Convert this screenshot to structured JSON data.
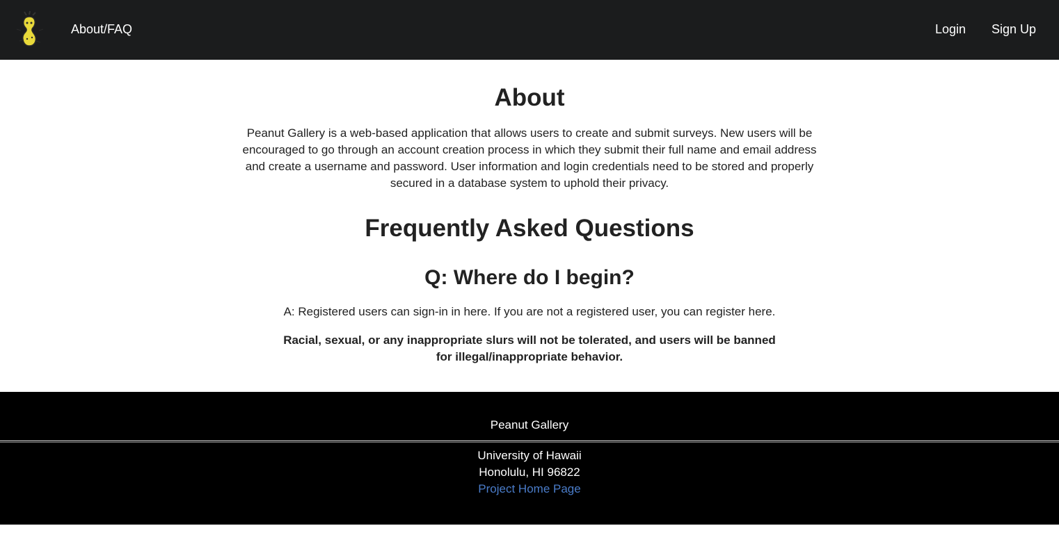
{
  "navbar": {
    "logo_icon": "peanut-logo-icon",
    "about_label": "About/FAQ",
    "login_label": "Login",
    "signup_label": "Sign Up"
  },
  "about": {
    "title": "About",
    "text": "Peanut Gallery is a web-based application that allows users to create and submit surveys. New users will be encouraged to go through an account creation process in which they submit their full name and email address and create a username and password. User information and login credentials need to be stored and properly secured in a database system to uphold their privacy."
  },
  "faq": {
    "title": "Frequently Asked Questions",
    "question": "Q: Where do I begin?",
    "answer": "A: Registered users can sign-in in here. If you are not a registered user, you can register here.",
    "warning": "Racial, sexual, or any inappropriate slurs will not be tolerated, and users will be banned for illegal/inappropriate behavior."
  },
  "footer": {
    "title": "Peanut Gallery",
    "university": "University of Hawaii",
    "city": "Honolulu, HI 96822",
    "project_link": "Project Home Page"
  },
  "colors": {
    "navbar_bg": "#1b1c1d",
    "footer_bg": "#000000",
    "link": "#4a7cc9",
    "peanut": "#e8d93a"
  }
}
